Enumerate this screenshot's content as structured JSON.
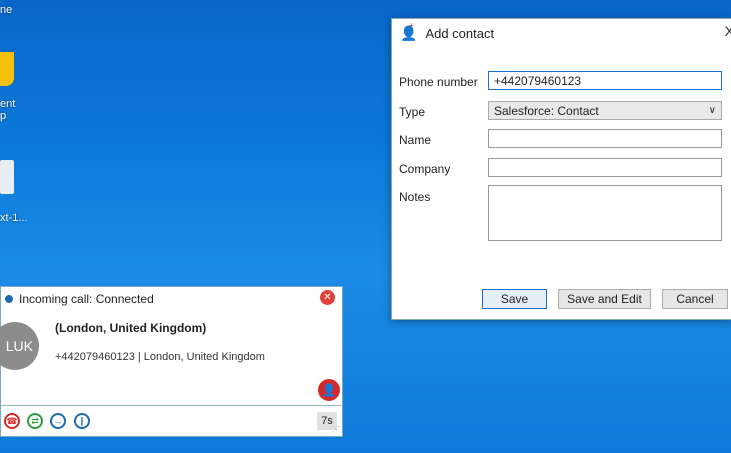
{
  "desktop": {
    "top_label": "ne",
    "icon1_label": "ent\np",
    "icon2_label": "xt-1..."
  },
  "add_contact": {
    "title": "Add contact",
    "close": "X",
    "fields": {
      "phone_label": "Phone number",
      "phone_value": "+442079460123",
      "type_label": "Type",
      "type_value": "Salesforce: Contact",
      "name_label": "Name",
      "name_value": "",
      "company_label": "Company",
      "company_value": "",
      "notes_label": "Notes",
      "notes_value": ""
    },
    "buttons": {
      "save": "Save",
      "save_edit": "Save and Edit",
      "cancel": "Cancel"
    }
  },
  "call": {
    "title": "Incoming call: Connected",
    "avatar_initials": "LUK",
    "caller_name": "(London, United Kingdom)",
    "caller_info": "+442079460123  |  London, United Kingdom",
    "timer": "7s"
  },
  "colors": {
    "accent": "#1a6fd1",
    "hangup": "#d42a2a",
    "transfer": "#2a9d3c",
    "forward": "#1e6ab0"
  }
}
